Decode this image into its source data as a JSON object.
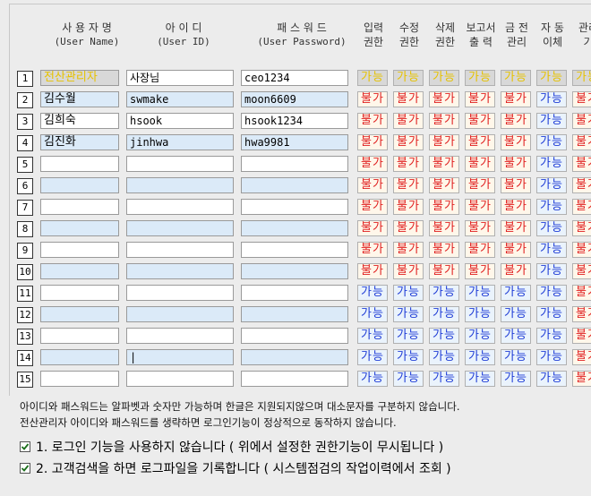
{
  "headers": {
    "username": {
      "label": "사 용 자 명",
      "sub": "(User Name)"
    },
    "userid": {
      "label": "아 이 디",
      "sub": "(User ID)"
    },
    "password": {
      "label": "패 스 워 드",
      "sub": "(User Password)"
    },
    "perms": [
      {
        "top": "입력",
        "bottom": "권한"
      },
      {
        "top": "수정",
        "bottom": "권한"
      },
      {
        "top": "삭제",
        "bottom": "권한"
      },
      {
        "top": "보고서",
        "bottom": "출 력"
      },
      {
        "top": "금 전",
        "bottom": "관리"
      },
      {
        "top": "자 동",
        "bottom": "이체"
      },
      {
        "top": "관리",
        "bottom": "기"
      }
    ]
  },
  "rows": [
    {
      "num": "1",
      "name": "전산관리자",
      "id": "사장님",
      "pw": "ceo1234",
      "perms": [
        "가능",
        "가능",
        "가능",
        "가능",
        "가능",
        "가능",
        "가능"
      ],
      "admin": true
    },
    {
      "num": "2",
      "name": "김수월",
      "id": "swmake",
      "pw": "moon6609",
      "perms": [
        "불가",
        "불가",
        "불가",
        "불가",
        "불가",
        "가능",
        "불가"
      ]
    },
    {
      "num": "3",
      "name": "김희숙",
      "id": "hsook",
      "pw": "hsook1234",
      "perms": [
        "불가",
        "불가",
        "불가",
        "불가",
        "불가",
        "가능",
        "불가"
      ]
    },
    {
      "num": "4",
      "name": "김진화",
      "id": "jinhwa",
      "pw": "hwa9981",
      "perms": [
        "불가",
        "불가",
        "불가",
        "불가",
        "불가",
        "가능",
        "불가"
      ]
    },
    {
      "num": "5",
      "name": "",
      "id": "",
      "pw": "",
      "perms": [
        "불가",
        "불가",
        "불가",
        "불가",
        "불가",
        "가능",
        "불가"
      ]
    },
    {
      "num": "6",
      "name": "",
      "id": "",
      "pw": "",
      "perms": [
        "불가",
        "불가",
        "불가",
        "불가",
        "불가",
        "가능",
        "불가"
      ]
    },
    {
      "num": "7",
      "name": "",
      "id": "",
      "pw": "",
      "perms": [
        "불가",
        "불가",
        "불가",
        "불가",
        "불가",
        "가능",
        "불가"
      ]
    },
    {
      "num": "8",
      "name": "",
      "id": "",
      "pw": "",
      "perms": [
        "불가",
        "불가",
        "불가",
        "불가",
        "불가",
        "가능",
        "불가"
      ]
    },
    {
      "num": "9",
      "name": "",
      "id": "",
      "pw": "",
      "perms": [
        "불가",
        "불가",
        "불가",
        "불가",
        "불가",
        "가능",
        "불가"
      ]
    },
    {
      "num": "10",
      "name": "",
      "id": "",
      "pw": "",
      "perms": [
        "불가",
        "불가",
        "불가",
        "불가",
        "불가",
        "가능",
        "불가"
      ]
    },
    {
      "num": "11",
      "name": "",
      "id": "",
      "pw": "",
      "perms": [
        "가능",
        "가능",
        "가능",
        "가능",
        "가능",
        "가능",
        "불가"
      ]
    },
    {
      "num": "12",
      "name": "",
      "id": "",
      "pw": "",
      "perms": [
        "가능",
        "가능",
        "가능",
        "가능",
        "가능",
        "가능",
        "불가"
      ]
    },
    {
      "num": "13",
      "name": "",
      "id": "",
      "pw": "",
      "perms": [
        "가능",
        "가능",
        "가능",
        "가능",
        "가능",
        "가능",
        "불가"
      ]
    },
    {
      "num": "14",
      "name": "",
      "id": "|",
      "pw": "",
      "perms": [
        "가능",
        "가능",
        "가능",
        "가능",
        "가능",
        "가능",
        "불가"
      ]
    },
    {
      "num": "15",
      "name": "",
      "id": "",
      "pw": "",
      "perms": [
        "가능",
        "가능",
        "가능",
        "가능",
        "가능",
        "가능",
        "불가"
      ]
    }
  ],
  "notes": [
    "아이디와 패스워드는 알파벳과 숫자만 가능하며 한글은 지원되지않으며 대소문자를 구분하지 않습니다.",
    "전산관리자 아이디와 패스워드를 생략하면 로그인기능이 정상적으로 동작하지 않습니다."
  ],
  "options": [
    {
      "label": "1. 로그인 기능을 사용하지 않습니다 ( 위에서 설정한 권한기능이 무시됩니다 )",
      "checked": true
    },
    {
      "label": "2. 고객검색을 하면 로그파일을 기록합니다 ( 시스템점검의 작업이력에서 조회 )",
      "checked": true
    }
  ],
  "colors": {
    "allowed": "#1f3dd6",
    "denied": "#e02020",
    "admin": "#e6c200",
    "alt_row": "#dbeaf8"
  }
}
